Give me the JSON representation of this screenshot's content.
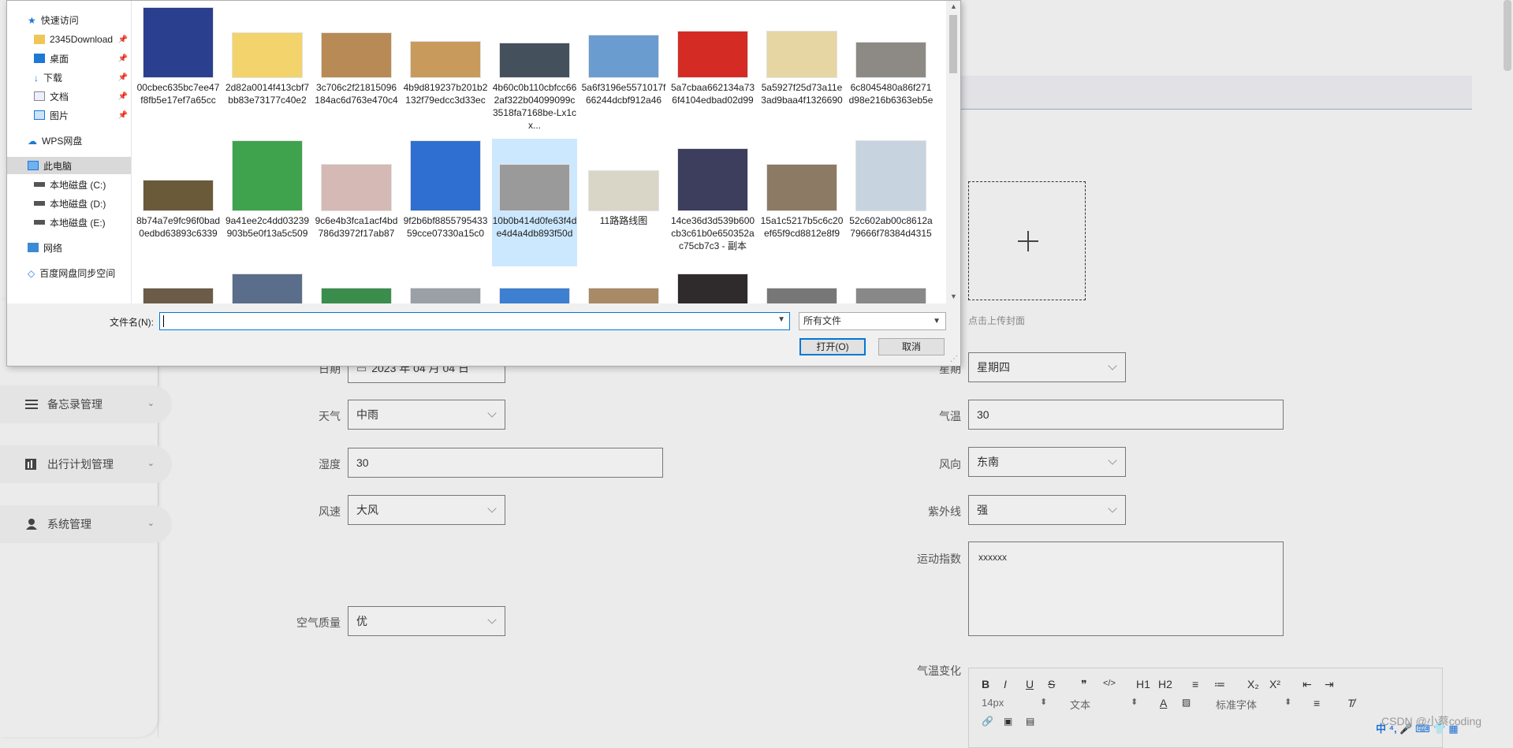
{
  "sidebar": {
    "items": [
      {
        "label": "备忘录管理",
        "icon": "list-icon"
      },
      {
        "label": "出行计划管理",
        "icon": "chart-icon"
      },
      {
        "label": "系统管理",
        "icon": "user-icon"
      }
    ]
  },
  "form": {
    "date": {
      "label": "日期",
      "value": "2023 年 04 月 04 日"
    },
    "weekday": {
      "label": "星期",
      "value": "星期四"
    },
    "weather": {
      "label": "天气",
      "value": "中雨"
    },
    "temperature": {
      "label": "气温",
      "value": "30"
    },
    "humidity": {
      "label": "湿度",
      "value": "30"
    },
    "wind_direction": {
      "label": "风向",
      "value": "东南"
    },
    "wind_speed": {
      "label": "风速",
      "value": "大风"
    },
    "uv": {
      "label": "紫外线",
      "value": "强"
    },
    "sport_index": {
      "label": "运动指数",
      "value": "xxxxxx"
    },
    "air_quality": {
      "label": "空气质量",
      "value": "优"
    },
    "temp_change": {
      "label": "气温变化"
    },
    "cover": {
      "hint": "点击上传封面"
    }
  },
  "editor": {
    "toolbar_row1": [
      "B",
      "I",
      "U",
      "S",
      "❞",
      "</>",
      "H1",
      "H2",
      "≡",
      "≔",
      "X₂",
      "X²",
      "⇤",
      "⇥"
    ],
    "font_size": "14px",
    "block_type": "文本",
    "font_family": "标准字体"
  },
  "watermark": "CSDN @小蔡coding",
  "tray": "中 ⁴, 🎤 ⌨ 👕 ▦",
  "dialog": {
    "nav": [
      {
        "label": "快速访问",
        "icon": "star-icon"
      },
      {
        "label": "2345Download",
        "icon": "folder-icon",
        "pinned": true
      },
      {
        "label": "桌面",
        "icon": "desktop-icon",
        "pinned": true
      },
      {
        "label": "下载",
        "icon": "download-icon",
        "pinned": true
      },
      {
        "label": "文档",
        "icon": "document-icon",
        "pinned": true
      },
      {
        "label": "图片",
        "icon": "picture-icon",
        "pinned": true
      },
      {
        "label": "WPS网盘",
        "icon": "cloud-icon"
      },
      {
        "label": "此电脑",
        "icon": "computer-icon"
      },
      {
        "label": "本地磁盘 (C:)",
        "icon": "disk-icon"
      },
      {
        "label": "本地磁盘 (D:)",
        "icon": "disk-icon"
      },
      {
        "label": "本地磁盘 (E:)",
        "icon": "disk-icon"
      },
      {
        "label": "网络",
        "icon": "network-icon"
      },
      {
        "label": "百度网盘同步空间",
        "icon": "baidu-icon"
      }
    ],
    "files_row1": [
      {
        "name": "00cbec635bc7ee47f8fb5e17ef7a65cc",
        "color": "#2b3f8f"
      },
      {
        "name": "2d82a0014f413cbf7bb83e73177c40e2",
        "color": "#f3d36b"
      },
      {
        "name": "3c706c2f21815096184ac6d763e470c4",
        "color": "#b88a55"
      },
      {
        "name": "4b9d819237b201b2132f79edcc3d33ec",
        "color": "#c89b5c"
      },
      {
        "name": "4b60c0b110cbfcc662af322b04099099c3518fa7168be-Lx1cx...",
        "color": "#45505d"
      },
      {
        "name": "5a6f3196e5571017f66244dcbf912a46",
        "color": "#6b9ccf"
      },
      {
        "name": "5a7cbaa662134a736f4104edbad02d99",
        "color": "#d42c25"
      },
      {
        "name": "5a5927f25d73a11e3ad9baa4f1326690",
        "color": "#e6d6a3"
      },
      {
        "name": "6c8045480a86f271d98e216b6363eb5e",
        "color": "#8d8a86"
      }
    ],
    "files_row2": [
      {
        "name": "8b74a7e9fc96f0bad0edbd63893c6339",
        "color": "#6a5a3a"
      },
      {
        "name": "9a41ee2c4dd03239903b5e0f13a5c509",
        "color": "#3fa34d"
      },
      {
        "name": "9c6e4b3fca1acf4bd786d3972f17ab87",
        "color": "#d5b9b5"
      },
      {
        "name": "9f2b6bf885579543359cce07330a15c0",
        "color": "#2f6fd1"
      },
      {
        "name": "10b0b414d0fe63f4de4d4a4db893f50d",
        "color": "#9a9a9a"
      },
      {
        "name": "11路路线图",
        "color": "#d9d6c8"
      },
      {
        "name": "14ce36d3d539b600cb3c61b0e650352ac75cb7c3 - 副本",
        "color": "#3d3d5e"
      },
      {
        "name": "15a1c5217b5c6c20ef65f9cd8812e8f9",
        "color": "#8c7a64"
      },
      {
        "name": "52c602ab00c8612a79666f78384d4315",
        "color": "#c7d3df"
      }
    ],
    "files_row3_colors": [
      "#6b5b47",
      "#5a6d8a",
      "#3b8d4c",
      "#9aa0a6",
      "#3d7fd1",
      "#a88a66",
      "#2f2a2c",
      "#777777",
      "#888888"
    ],
    "filename_label": "文件名(N):",
    "filename_value": "",
    "filetype": "所有文件",
    "open_button": "打开(O)",
    "cancel_button": "取消"
  }
}
